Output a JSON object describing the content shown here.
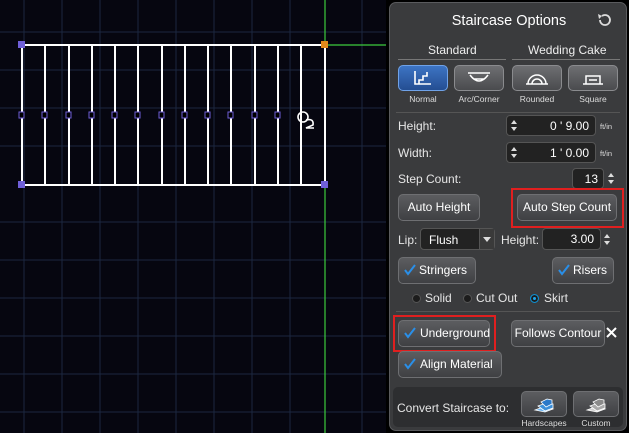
{
  "panel": {
    "title": "Staircase Options",
    "groups": {
      "standard": "Standard",
      "wedding_cake": "Wedding Cake"
    },
    "types": [
      {
        "label": "Normal",
        "icon": "normal-stair-icon",
        "selected": true
      },
      {
        "label": "Arc/Corner",
        "icon": "arc-corner-stair-icon",
        "selected": false
      },
      {
        "label": "Rounded",
        "icon": "rounded-stair-icon",
        "selected": false
      },
      {
        "label": "Square",
        "icon": "square-stair-icon",
        "selected": false
      }
    ],
    "height": {
      "label": "Height:",
      "value": "0 ' 9.00",
      "unit": "ft/in"
    },
    "width": {
      "label": "Width:",
      "value": "1 ' 0.00",
      "unit": "ft/in"
    },
    "step_count": {
      "label": "Step Count:",
      "value": "13"
    },
    "auto_height": "Auto Height",
    "auto_step_count": "Auto Step Count",
    "lip": {
      "label": "Lip:",
      "value": "Flush"
    },
    "lip_height": {
      "label": "Height:",
      "value": "3.00"
    },
    "stringers": {
      "label": "Stringers",
      "checked": true
    },
    "risers": {
      "label": "Risers",
      "checked": true
    },
    "riser_styles": [
      {
        "label": "Solid",
        "selected": false
      },
      {
        "label": "Cut Out",
        "selected": false
      },
      {
        "label": "Skirt",
        "selected": true
      }
    ],
    "underground": {
      "label": "Underground",
      "checked": true
    },
    "follows_contour": {
      "label": "Follows Contour"
    },
    "align_material": {
      "label": "Align Material",
      "checked": true
    },
    "convert": {
      "label": "Convert Staircase to:",
      "hardscapes": "Hardscapes",
      "custom": "Custom"
    }
  },
  "colors": {
    "accent_blue": "#2a8fe8",
    "highlight_red": "#e01f1f",
    "guide_green": "#3ccc3c",
    "handle_purple": "#6f5fd8",
    "handle_orange": "#e08a1c"
  }
}
